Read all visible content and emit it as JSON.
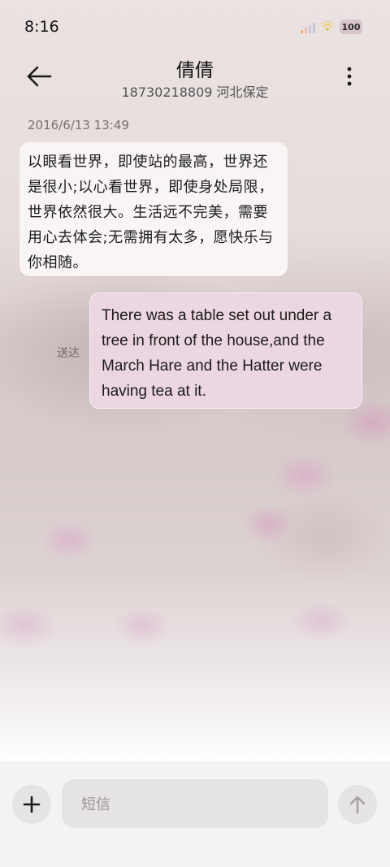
{
  "status_bar": {
    "time": "8:16",
    "battery": "100",
    "icons": [
      "signal-icon",
      "wifi-icon",
      "battery-icon"
    ]
  },
  "header": {
    "title": "倩倩",
    "subtitle": "18730218809 河北保定",
    "icons": [
      "back-arrow-icon",
      "more-vertical-icon"
    ]
  },
  "conversation": {
    "timestamp": "2016/6/13 13:49",
    "messages": [
      {
        "direction": "incoming",
        "text": "以眼看世界，即使站的最高，世界还是很小;以心看世界，即使身处局限，世界依然很大。生活远不完美，需要用心去体会;无需拥有太多，愿快乐与你相随。"
      },
      {
        "direction": "outgoing",
        "text": "There was a table set out under a tree in front of the house,and the March Hare and the Hatter were having tea at it.",
        "status": "送达"
      }
    ]
  },
  "composer": {
    "placeholder": "短信",
    "icons": [
      "plus-icon",
      "send-arrow-up-icon"
    ]
  },
  "colors": {
    "incoming_bubble": "#faf6f6",
    "outgoing_bubble": "#ecd6e2",
    "bottom_bar": "#f4f2f2",
    "battery_badge": "#d8c4cc"
  }
}
